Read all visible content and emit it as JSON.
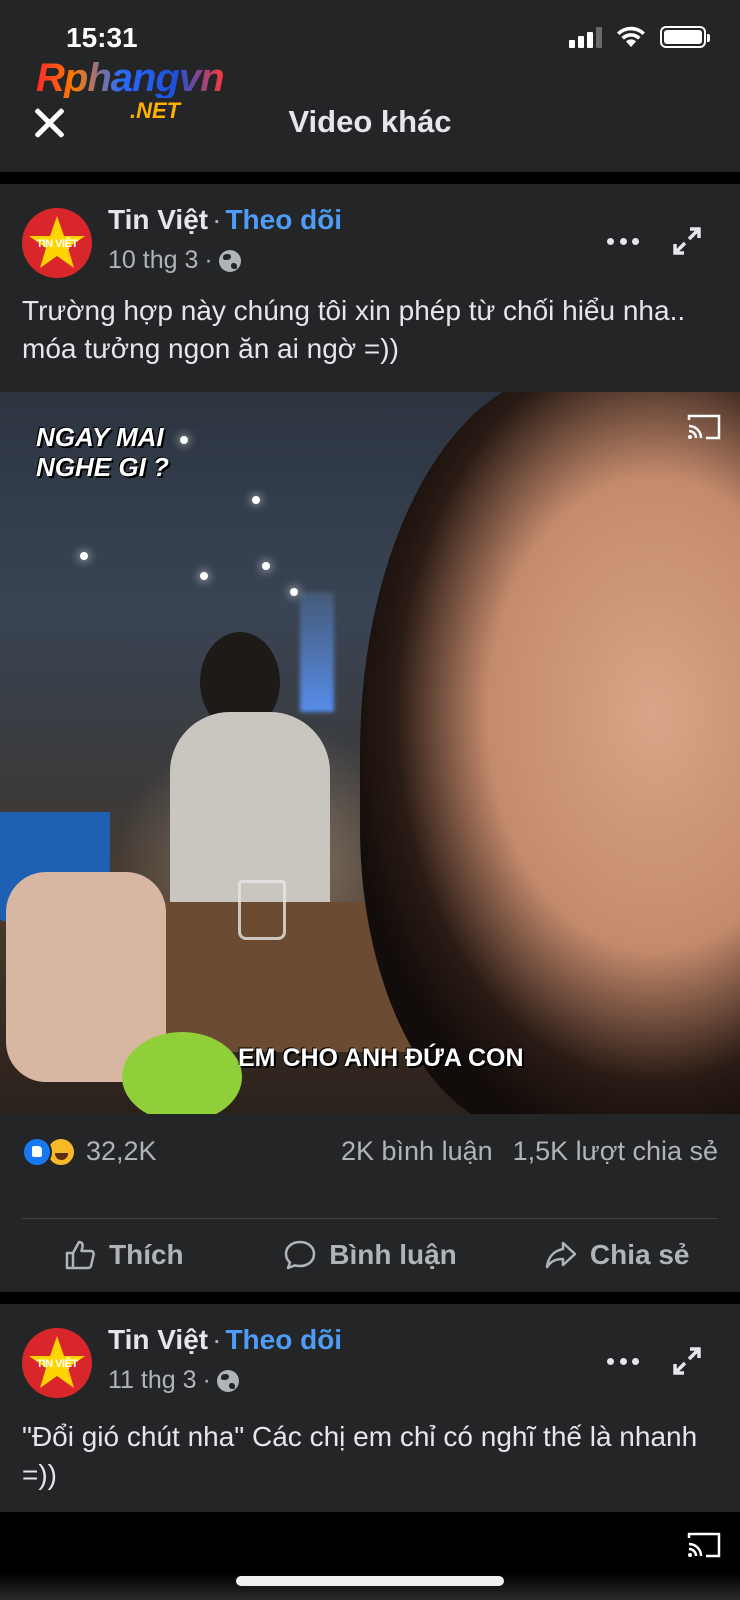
{
  "status_bar": {
    "time": "15:31"
  },
  "logo": {
    "main": "Rphangvn",
    "sub": ".NET"
  },
  "header": {
    "title": "Video khác"
  },
  "posts": [
    {
      "author": "Tin Việt",
      "follow_label": "Theo dõi",
      "avatar_text": "TIN VIỆT",
      "date": "10 thg 3",
      "text": "Trường hợp này chúng tôi xin phép từ chối hiểu nha.. móa tưởng ngon ăn ai ngờ =))",
      "video": {
        "caption_top": "NGAY MAI NGHE GI ?",
        "caption_bottom": "EM CHO ANH ĐỨA CON"
      },
      "reactions_count": "32,2K",
      "comments": "2K bình luận",
      "shares": "1,5K lượt chia sẻ",
      "actions": {
        "like": "Thích",
        "comment": "Bình luận",
        "share": "Chia sẻ"
      }
    },
    {
      "author": "Tin Việt",
      "follow_label": "Theo dõi",
      "avatar_text": "TIN VIỆT",
      "date": "11 thg 3",
      "text": "\"Đổi gió chút nha\" Các chị em chỉ có nghĩ thế là nhanh =))"
    }
  ],
  "icons": {
    "close": "close-icon",
    "more": "more-icon",
    "expand": "expand-icon",
    "cast": "cast-icon",
    "globe": "globe-icon",
    "like": "like-icon",
    "comment": "comment-icon",
    "share": "share-icon"
  },
  "colors": {
    "background": "#000000",
    "card": "#242526",
    "text": "#e4e6eb",
    "secondary_text": "#b0b3b8",
    "follow_link": "#4e9cf5",
    "like_reaction": "#1877f2",
    "haha_reaction": "#f7b928"
  }
}
